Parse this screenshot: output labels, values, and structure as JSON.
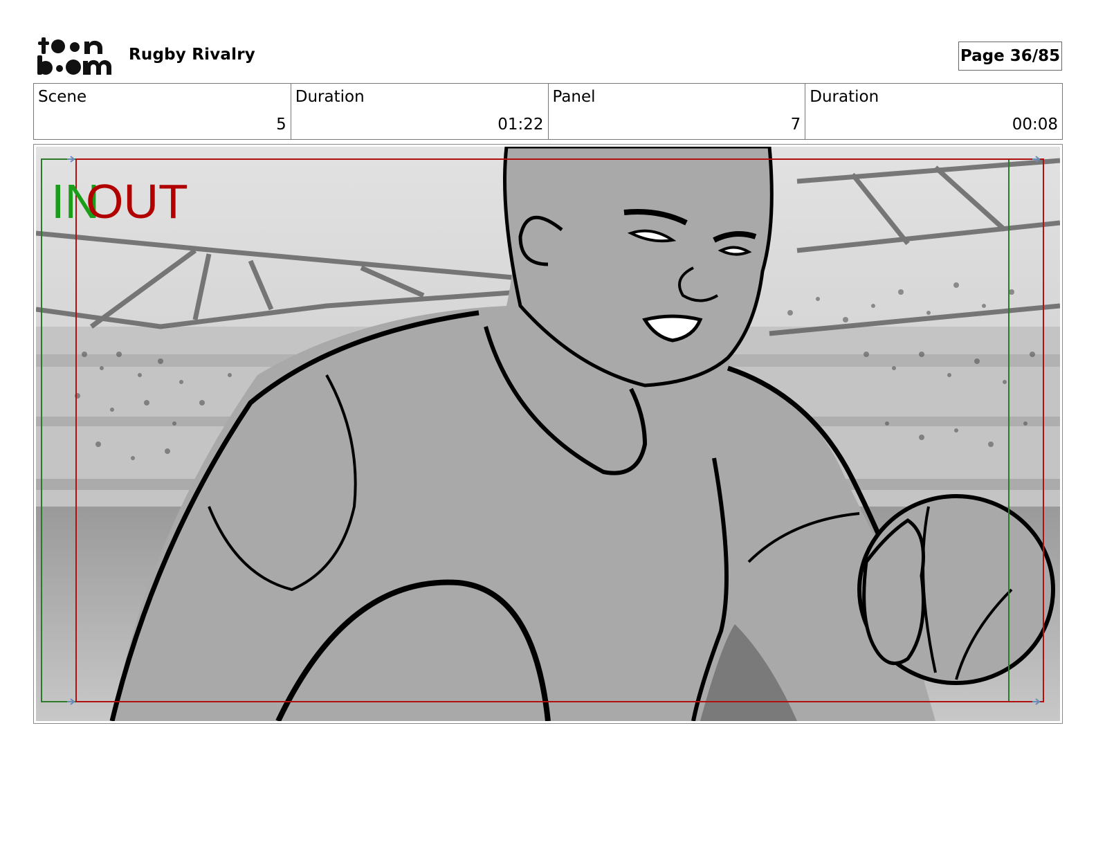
{
  "header": {
    "logo_text": "toon boom",
    "project_title": "Rugby Rivalry",
    "page_label": "Page 36/85"
  },
  "info": [
    {
      "label": "Scene",
      "value": "5"
    },
    {
      "label": "Duration",
      "value": "01:22"
    },
    {
      "label": "Panel",
      "value": "7"
    },
    {
      "label": "Duration",
      "value": "00:08"
    }
  ],
  "panel": {
    "in_marker": "IN",
    "out_marker": "OUT",
    "colors": {
      "in": "#1a9e1a",
      "out": "#b00000",
      "frame_in": "#2a7a2a",
      "frame_out": "#b01010"
    }
  }
}
